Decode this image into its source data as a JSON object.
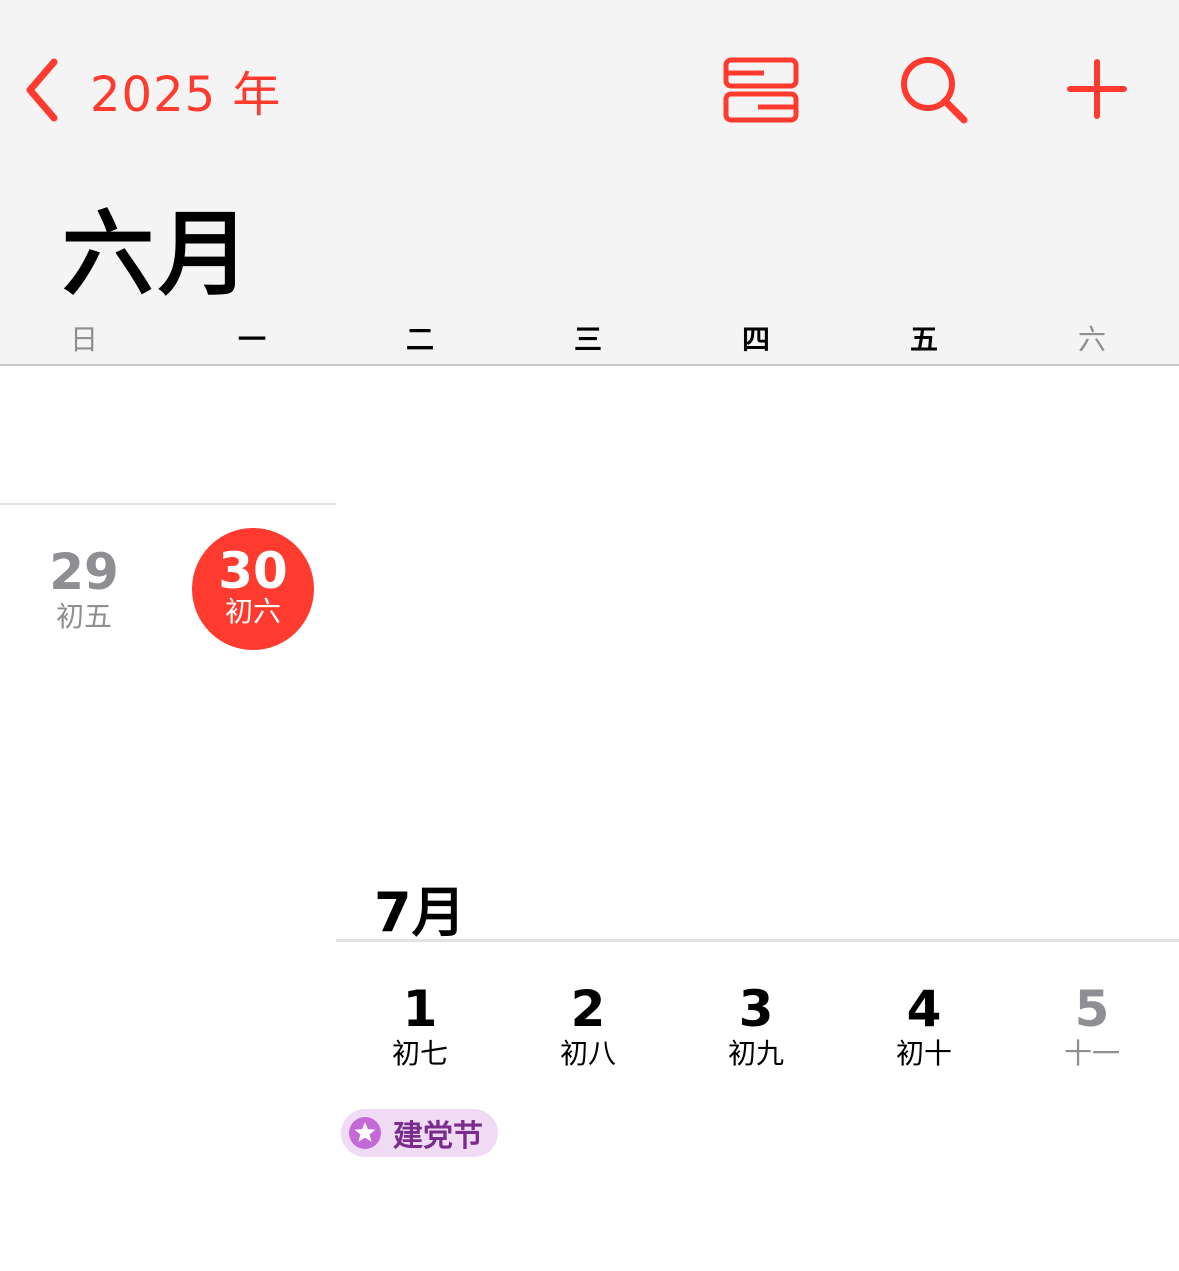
{
  "header": {
    "back_label": "2025 年",
    "month_title": "六月",
    "accent_color": "#ff3b30"
  },
  "toolbar": {
    "list_view_icon": "list-view-icon",
    "search_icon": "search-icon",
    "add_icon": "plus-icon"
  },
  "weekdays": [
    "日",
    "一",
    "二",
    "三",
    "四",
    "五",
    "六"
  ],
  "june_days": [
    {
      "day": "29",
      "lunar": "初五"
    },
    {
      "day": "30",
      "lunar": "初六",
      "today": true
    }
  ],
  "july": {
    "label": "7月",
    "days": [
      {
        "day": "1",
        "lunar": "初七"
      },
      {
        "day": "2",
        "lunar": "初八"
      },
      {
        "day": "3",
        "lunar": "初九"
      },
      {
        "day": "4",
        "lunar": "初十"
      },
      {
        "day": "5",
        "lunar": "十一"
      }
    ]
  },
  "events": [
    {
      "label": "建党节",
      "icon": "star-icon",
      "color": "#c46ad8"
    }
  ]
}
